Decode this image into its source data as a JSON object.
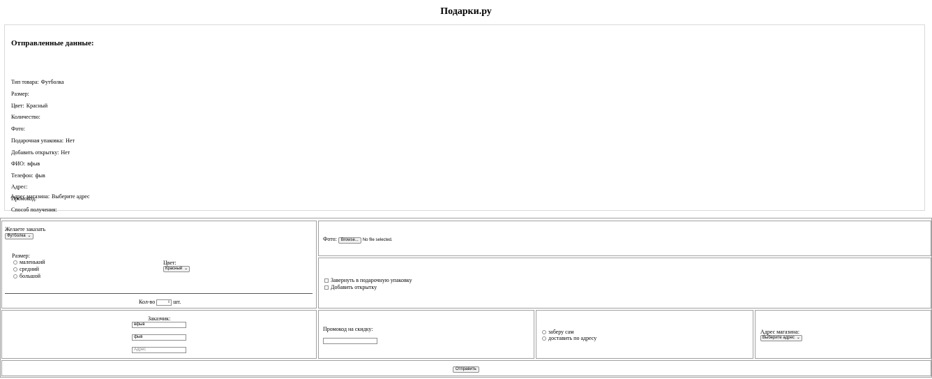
{
  "page": {
    "title": "Подарки.ру"
  },
  "summary": {
    "heading": "Отправленные данные:",
    "rows": [
      {
        "key": "Тип товара:",
        "value": "Футболка"
      },
      {
        "key": "Размер:",
        "value": ""
      },
      {
        "key": "Цвет:",
        "value": "Красный"
      },
      {
        "key": "Количество:",
        "value": ""
      },
      {
        "key": "Фото:",
        "value": ""
      },
      {
        "key": "Подарочная упаковка:",
        "value": "Нет"
      },
      {
        "key": "Добавить открытку:",
        "value": "Нет"
      },
      {
        "key": "ФИО:",
        "value": "вфыв"
      },
      {
        "key": "Телефон:",
        "value": "фыв"
      },
      {
        "key": "Адрес:",
        "value": ""
      },
      {
        "key": "Промокод:",
        "value": ""
      },
      {
        "key": "Способ получения:",
        "value": ""
      },
      {
        "key": "Адрес магазина:",
        "value": "Выберите адрес"
      }
    ]
  },
  "form": {
    "product": {
      "label": "Желаете заказать",
      "selected": "Футболка"
    },
    "size": {
      "label": "Размер:",
      "options": [
        "маленький",
        "средний",
        "большой"
      ]
    },
    "color": {
      "label": "Цвет:",
      "selected": "Красный"
    },
    "quantity": {
      "label": "Кол-во",
      "unit": "шт.",
      "value": ""
    },
    "photo": {
      "label": "Фото:",
      "button": "Browse...",
      "status": "No file selected."
    },
    "extras": {
      "gift_wrap": "Завернуть в подарочную упаковку",
      "card": "Добавить открытку"
    },
    "customer": {
      "label": "Заказчик:",
      "name_value": "вфыв",
      "phone_value": "фыв",
      "address_placeholder": "Адрес"
    },
    "promo": {
      "label": "Промокод на скидку:",
      "value": ""
    },
    "delivery": {
      "options": [
        "заберу сам",
        "доставить по адресу"
      ]
    },
    "store": {
      "label": "Адрес магазина:",
      "selected": "Выберите адрес"
    },
    "submit": "Отправить"
  }
}
